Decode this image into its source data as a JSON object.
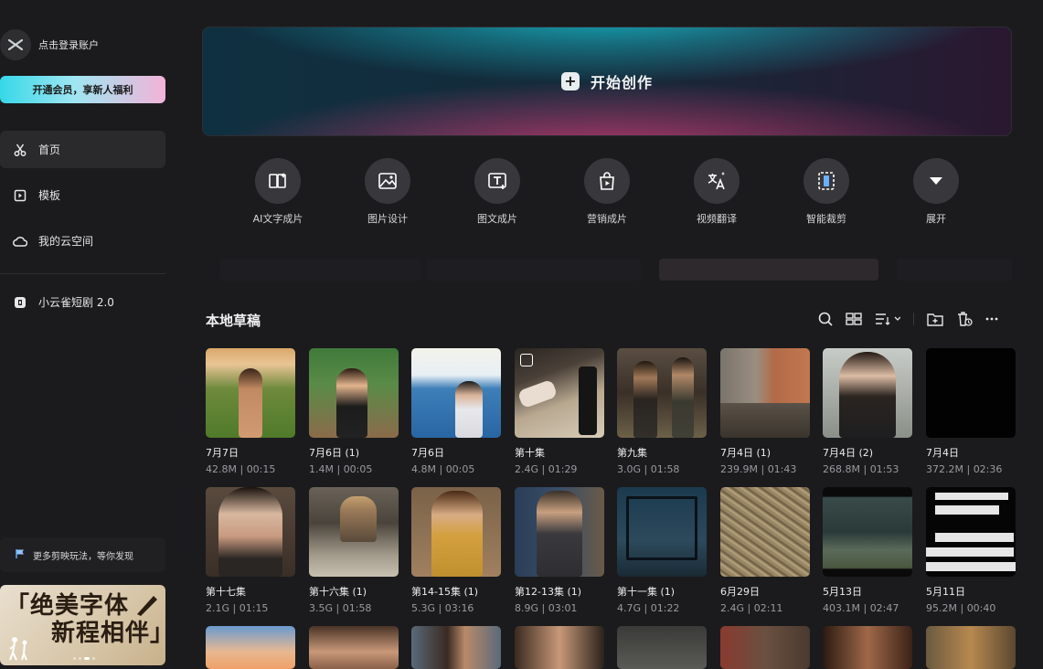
{
  "sidebar": {
    "account_label": "点击登录账户",
    "vip_label": "开通会员，享新人福利",
    "nav": [
      {
        "label": "首页",
        "icon": "scissors-icon",
        "active": true
      },
      {
        "label": "模板",
        "icon": "template-icon",
        "active": false
      },
      {
        "label": "我的云空间",
        "icon": "cloud-icon",
        "active": false
      }
    ],
    "drama_label": "小云雀短剧 2.0",
    "promo_label": "更多剪映玩法，等你发现",
    "banner_text_line1": "「绝美字体",
    "banner_text_line2": "新程相伴」"
  },
  "hero": {
    "label": "开始创作",
    "icon": "plus-icon"
  },
  "tools": [
    {
      "label": "AI文字成片",
      "icon": "ai-text-icon"
    },
    {
      "label": "图片设计",
      "icon": "image-design-icon"
    },
    {
      "label": "图文成片",
      "icon": "text-image-icon"
    },
    {
      "label": "营销成片",
      "icon": "marketing-bag-icon"
    },
    {
      "label": "视频翻译",
      "icon": "translate-icon"
    },
    {
      "label": "智能裁剪",
      "icon": "smart-crop-icon"
    },
    {
      "label": "展开",
      "icon": "chevron-down-icon"
    }
  ],
  "drafts": {
    "title": "本地草稿",
    "toolbar_icons": [
      "search-icon",
      "view-toggle-icon",
      "sort-icon",
      "new-folder-icon",
      "recycle-icon",
      "more-icon"
    ],
    "items": [
      {
        "name": "7月7日",
        "size": "42.8M",
        "duration": "00:15"
      },
      {
        "name": "7月6日 (1)",
        "size": "1.4M",
        "duration": "00:05"
      },
      {
        "name": "7月6日",
        "size": "4.8M",
        "duration": "00:05"
      },
      {
        "name": "第十集",
        "size": "2.4G",
        "duration": "01:29"
      },
      {
        "name": "第九集",
        "size": "3.0G",
        "duration": "01:58"
      },
      {
        "name": "7月4日 (1)",
        "size": "239.9M",
        "duration": "01:43"
      },
      {
        "name": "7月4日 (2)",
        "size": "268.8M",
        "duration": "01:53"
      },
      {
        "name": "7月4日",
        "size": "372.2M",
        "duration": "02:36"
      },
      {
        "name": "第十七集",
        "size": "2.1G",
        "duration": "01:15"
      },
      {
        "name": "第十六集 (1)",
        "size": "3.5G",
        "duration": "01:58"
      },
      {
        "name": "第14-15集 (1)",
        "size": "5.3G",
        "duration": "03:16"
      },
      {
        "name": "第12-13集 (1)",
        "size": "8.9G",
        "duration": "03:01"
      },
      {
        "name": "第十一集 (1)",
        "size": "4.7G",
        "duration": "01:22"
      },
      {
        "name": "6月29日",
        "size": "2.4G",
        "duration": "02:11"
      },
      {
        "name": "5月13日",
        "size": "403.1M",
        "duration": "02:47"
      },
      {
        "name": "5月11日",
        "size": "95.2M",
        "duration": "00:40"
      }
    ]
  }
}
